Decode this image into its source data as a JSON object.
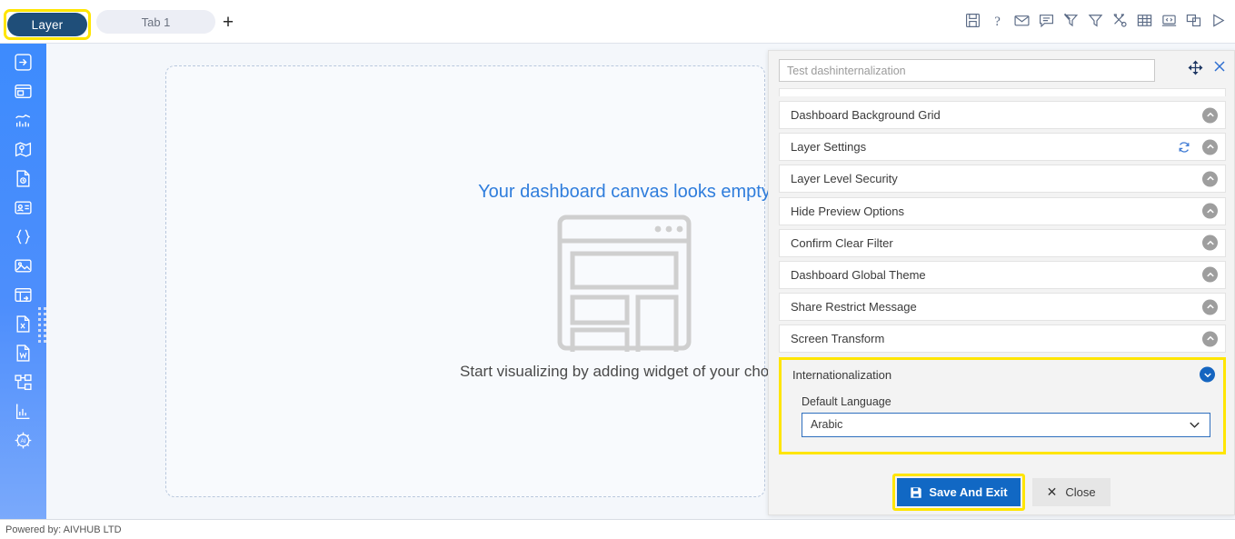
{
  "tabbar": {
    "layer_tab": "Layer",
    "tab1": "Tab 1",
    "add_tab": "+",
    "icons": [
      {
        "name": "save-icon",
        "title": "Save"
      },
      {
        "name": "help-icon",
        "title": "Help"
      },
      {
        "name": "mail-icon",
        "title": "Mail"
      },
      {
        "name": "comment-icon",
        "title": "Comment"
      },
      {
        "name": "clear-filter-icon",
        "title": "Clear Filter"
      },
      {
        "name": "filter-icon",
        "title": "Filter"
      },
      {
        "name": "tools-icon",
        "title": "Tools"
      },
      {
        "name": "table-icon",
        "title": "Table"
      },
      {
        "name": "embed-code-icon",
        "title": "Embed"
      },
      {
        "name": "duplicate-icon",
        "title": "Duplicate"
      },
      {
        "name": "play-icon",
        "title": "Preview"
      }
    ]
  },
  "sidebar": {
    "items": [
      {
        "icon": "login-arrow-icon",
        "label": "Login"
      },
      {
        "icon": "layout-panel-icon",
        "label": "Layout"
      },
      {
        "icon": "chart-line-icon",
        "label": "Chart"
      },
      {
        "icon": "map-pin-icon",
        "label": "Map"
      },
      {
        "icon": "document-clock-icon",
        "label": "Document"
      },
      {
        "icon": "id-card-icon",
        "label": "Card"
      },
      {
        "icon": "braces-icon",
        "label": "Code"
      },
      {
        "icon": "image-icon",
        "label": "Image"
      },
      {
        "icon": "grid-export-icon",
        "label": "Grid"
      },
      {
        "icon": "excel-file-icon",
        "label": "Excel"
      },
      {
        "icon": "word-file-icon",
        "label": "Word"
      },
      {
        "icon": "hierarchy-icon",
        "label": "Hierarchy"
      },
      {
        "icon": "bar-chart-icon",
        "label": "Analytics"
      },
      {
        "icon": "ai-chip-icon",
        "label": "AI"
      }
    ],
    "drag_handle": "drag-handle"
  },
  "canvas": {
    "empty_title": "Your dashboard canvas looks empty",
    "empty_subtitle": "Start visualizing by adding widget of your choice"
  },
  "panel": {
    "title_value": "Test dashinternalization",
    "title_placeholder": "Test dashinternalization",
    "move_icon": "move-icon",
    "close_icon": "close-icon",
    "sections": [
      {
        "label": "Dashboard Background Grid",
        "expanded": false,
        "refresh": false
      },
      {
        "label": "Layer Settings",
        "expanded": false,
        "refresh": true
      },
      {
        "label": "Layer Level Security",
        "expanded": false,
        "refresh": false
      },
      {
        "label": "Hide Preview Options",
        "expanded": false,
        "refresh": false
      },
      {
        "label": "Confirm Clear Filter",
        "expanded": false,
        "refresh": false
      },
      {
        "label": "Dashboard Global Theme",
        "expanded": false,
        "refresh": false
      },
      {
        "label": "Share Restrict Message",
        "expanded": false,
        "refresh": false
      },
      {
        "label": "Screen Transform",
        "expanded": false,
        "refresh": false
      }
    ],
    "internationalization": {
      "label": "Internationalization",
      "expanded": true,
      "field_label": "Default Language",
      "field_value": "Arabic",
      "options": [
        "Arabic"
      ]
    },
    "footer": {
      "save_label": "Save And Exit",
      "close_label": "Close"
    }
  },
  "footer": {
    "powered_by": "Powered by: AIVHUB LTD"
  },
  "colors": {
    "accent_blue": "#1168c4",
    "sidebar_blue": "#4d8efc",
    "highlight_yellow": "#ffe500",
    "layer_tab_navy": "#1f4e79",
    "canvas_title_blue": "#2f7ddc"
  }
}
